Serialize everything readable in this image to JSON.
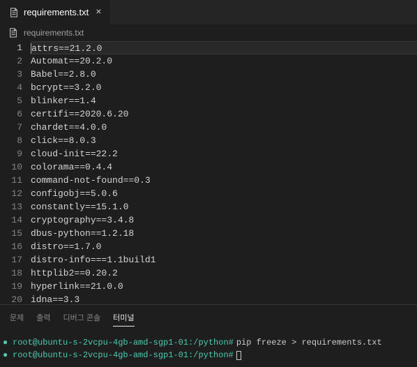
{
  "tab": {
    "filename": "requirements.txt",
    "close": "×"
  },
  "breadcrumb": {
    "filename": "requirements.txt"
  },
  "lines": [
    "attrs==21.2.0",
    "Automat==20.2.0",
    "Babel==2.8.0",
    "bcrypt==3.2.0",
    "blinker==1.4",
    "certifi==2020.6.20",
    "chardet==4.0.0",
    "click==8.0.3",
    "cloud-init==22.2",
    "colorama==0.4.4",
    "command-not-found==0.3",
    "configobj==5.0.6",
    "constantly==15.1.0",
    "cryptography==3.4.8",
    "dbus-python==1.2.18",
    "distro==1.7.0",
    "distro-info===1.1build1",
    "httplib2==0.20.2",
    "hyperlink==21.0.0",
    "idna==3.3"
  ],
  "line_numbers": [
    "1",
    "2",
    "3",
    "4",
    "5",
    "6",
    "7",
    "8",
    "9",
    "10",
    "11",
    "12",
    "13",
    "14",
    "15",
    "16",
    "17",
    "18",
    "19",
    "20"
  ],
  "panel": {
    "tabs": [
      "문제",
      "출력",
      "디버그 콘솔",
      "터미널"
    ]
  },
  "terminal": {
    "line1_prompt": "root@ubuntu-s-2vcpu-4gb-amd-sgp1-01:/python#",
    "line1_cmd": "pip freeze > requirements.txt",
    "line2_prompt": "root@ubuntu-s-2vcpu-4gb-amd-sgp1-01:/python#"
  }
}
